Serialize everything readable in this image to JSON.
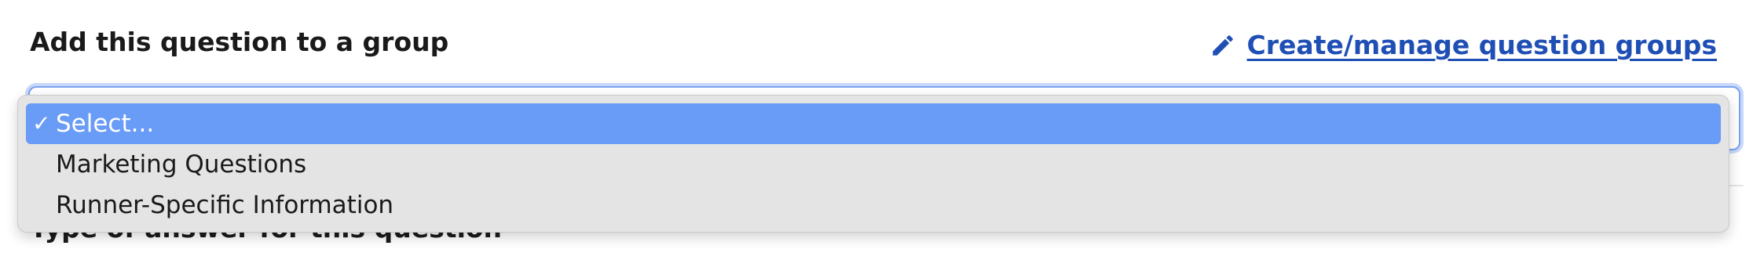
{
  "form": {
    "group_label": "Add this question to a group",
    "manage_link": "Create/manage question groups",
    "manage_icon": "pencil-icon",
    "next_label": "Type of answer for this question"
  },
  "dropdown": {
    "selected_check": "✓",
    "options": [
      {
        "label": "Select...",
        "selected": true
      },
      {
        "label": "Marketing Questions",
        "selected": false
      },
      {
        "label": "Runner-Specific Information",
        "selected": false
      }
    ]
  },
  "colors": {
    "link": "#1f4fb5",
    "highlight": "#699cf6",
    "focus_ring": "#c8d8fb",
    "menu_bg": "#e4e4e4"
  }
}
